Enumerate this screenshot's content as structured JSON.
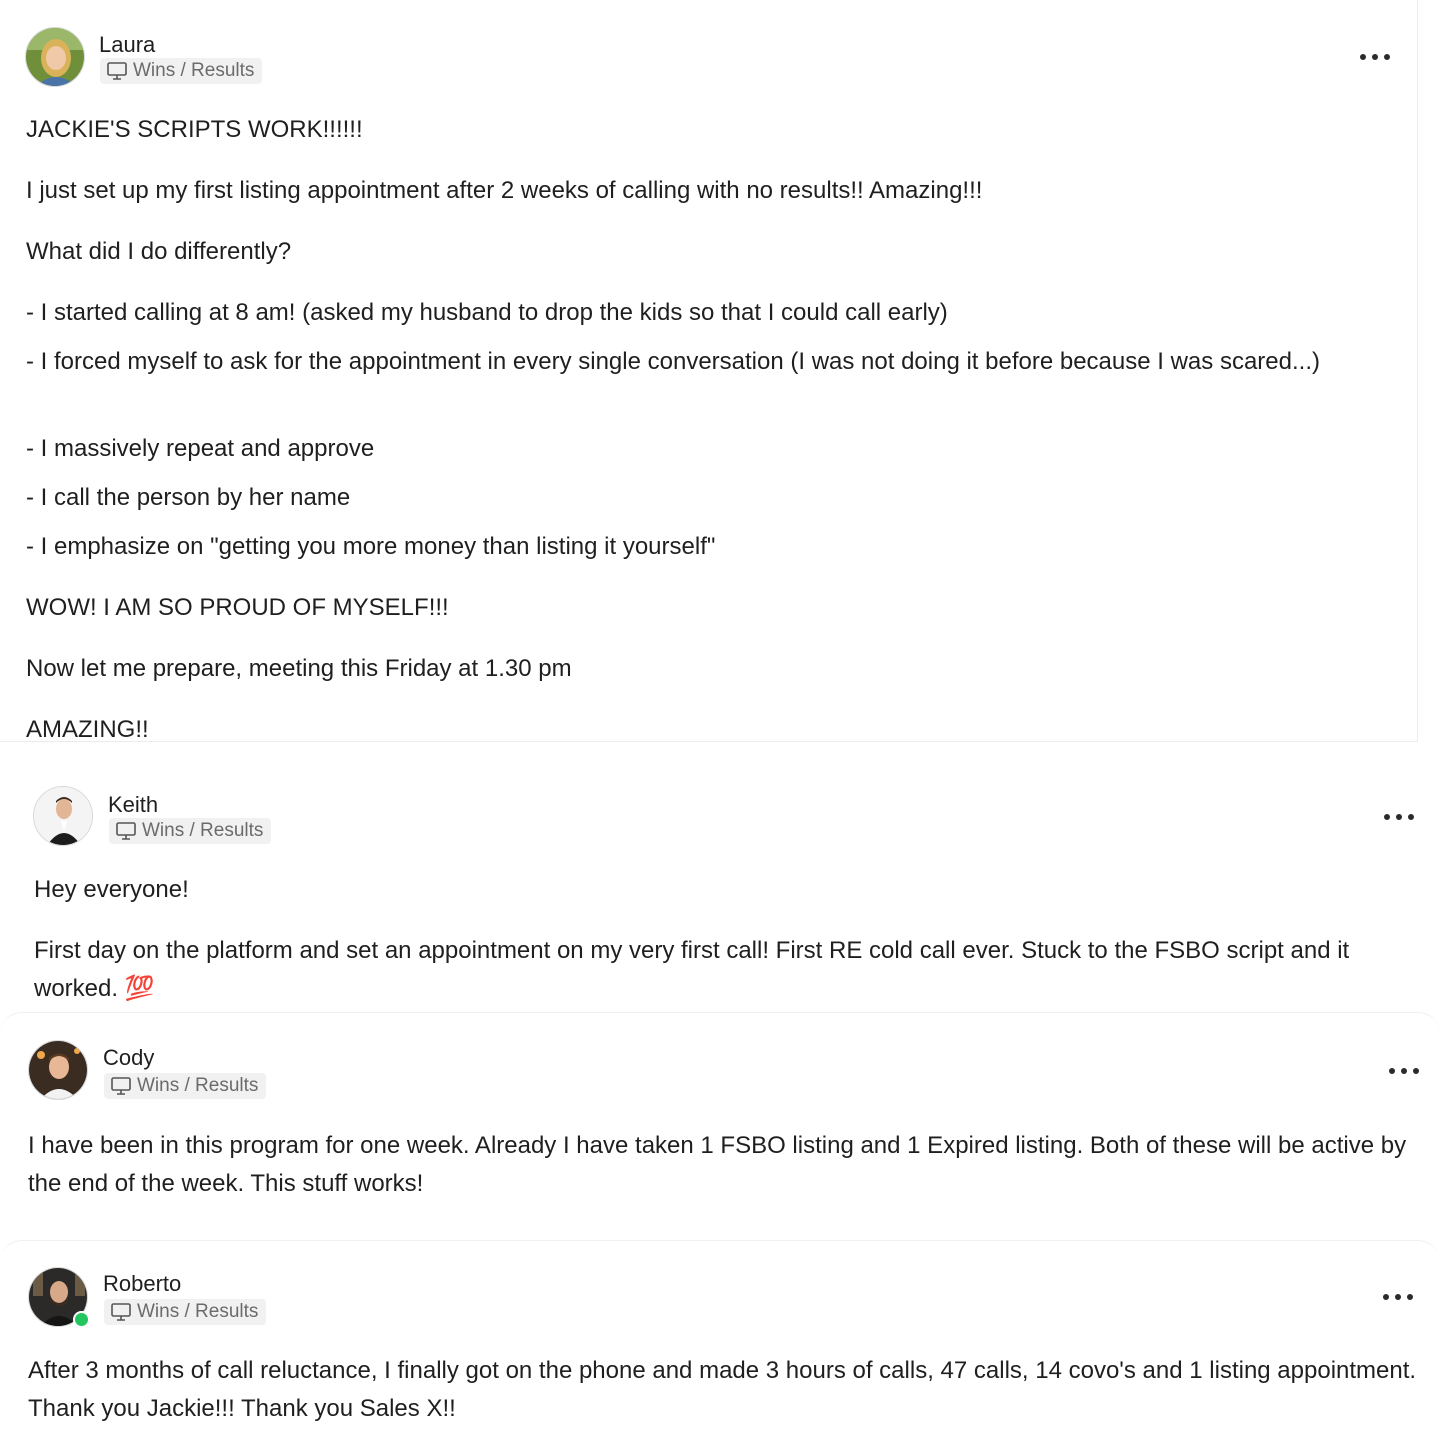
{
  "posts": [
    {
      "author": "Laura",
      "category": "Wins / Results",
      "paragraphs": [
        "JACKIE'S SCRIPTS WORK!!!!!!",
        "I just set up my first listing appointment after 2 weeks of calling with no results!! Amazing!!!",
        "What did I do differently?",
        "- I started calling at 8 am! (asked my husband to drop the kids so that I could call early)",
        "- I forced myself to ask for the appointment in every single conversation (I was not doing it before because I was scared...)",
        "- I massively repeat and approve",
        "- I call the person by her name",
        "- I emphasize on \"getting you more money than listing it yourself\"",
        "WOW! I AM SO PROUD OF MYSELF!!!",
        "Now let me prepare, meeting this Friday at 1.30 pm",
        "AMAZING!!"
      ]
    },
    {
      "author": "Keith",
      "category": "Wins / Results",
      "paragraphs": [
        "Hey everyone!",
        "First day on the platform and set an appointment on my very first call! First RE cold call ever. Stuck to the FSBO script and it worked. 💯"
      ]
    },
    {
      "author": "Cody",
      "category": "Wins / Results",
      "paragraphs": [
        "I have been in this program for one week. Already I have taken 1 FSBO listing and 1 Expired listing. Both of these will be active by the end of the week. This stuff works!"
      ]
    },
    {
      "author": "Roberto",
      "category": "Wins / Results",
      "online": true,
      "paragraphs": [
        "After 3 months of call reluctance, I finally got on the phone and made 3 hours of calls, 47 calls, 14 covo's and 1 listing appointment. Thank you Jackie!!! Thank you Sales X!!"
      ]
    }
  ],
  "icons": {
    "category": "monitor-icon",
    "menu": "more-horizontal-icon"
  },
  "colors": {
    "online": "#22c55e",
    "chip_bg": "#f1f1f1",
    "chip_text": "#6b6b6b"
  }
}
